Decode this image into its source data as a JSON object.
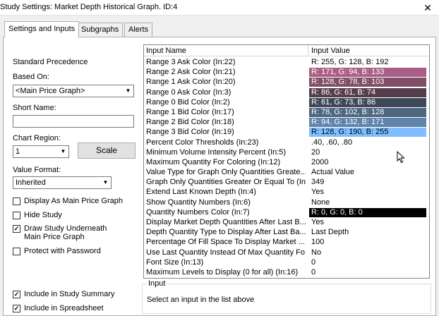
{
  "window": {
    "title": "Study Settings: Market Depth Historical Graph. ID:4",
    "close": "✕"
  },
  "tabs": [
    {
      "label": "Settings and Inputs"
    },
    {
      "label": "Subgraphs"
    },
    {
      "label": "Alerts"
    }
  ],
  "left": {
    "standard_precedence": "Standard Precedence",
    "based_on_label": "Based On:",
    "based_on_value": "<Main Price Graph>",
    "short_name_label": "Short Name:",
    "short_name_value": "",
    "chart_region_label": "Chart Region:",
    "chart_region_value": "1",
    "scale_button": "Scale",
    "value_format_label": "Value Format:",
    "value_format_value": "Inherited",
    "checkboxes": [
      {
        "label": "Display As Main Price Graph",
        "checked": false
      },
      {
        "label": "Hide Study",
        "checked": false
      },
      {
        "label": "Draw Study Underneath",
        "label2": "Main Price Graph",
        "checked": true
      },
      {
        "label": "Protect with Password",
        "checked": false
      },
      {
        "label": "Include in Study Summary",
        "checked": true
      },
      {
        "label": "Include in Spreadsheet",
        "checked": true
      }
    ]
  },
  "grid": {
    "col_name": "Input Name",
    "col_value": "Input Value",
    "rows": [
      {
        "name": "Range 3 Ask Color   (In:22)",
        "value": "R: 255, G: 128, B: 192",
        "bg": "#ffffff",
        "fg": "#000000"
      },
      {
        "name": "Range 2 Ask Color   (In:21)",
        "value": "R: 171, G: 94, B: 133",
        "bg": "#ab5e85",
        "fg": "#ffffff"
      },
      {
        "name": "Range 1 Ask Color   (In:20)",
        "value": "R: 128, G: 78, B: 103",
        "bg": "#804e67",
        "fg": "#ffffff"
      },
      {
        "name": "Range 0 Ask Color   (In:3)",
        "value": "R: 86, G: 61, B: 74",
        "bg": "#563d4a",
        "fg": "#ffffff"
      },
      {
        "name": "Range 0 Bid Color   (In:2)",
        "value": "R: 61, G: 73, B: 86",
        "bg": "#3d4956",
        "fg": "#ffffff"
      },
      {
        "name": "Range 1 Bid Color   (In:17)",
        "value": "R: 78, G: 102, B: 128",
        "bg": "#4e6680",
        "fg": "#ffffff"
      },
      {
        "name": "Range 2 Bid Color   (In:18)",
        "value": "R: 94, G: 132, B: 171",
        "bg": "#5e84ab",
        "fg": "#ffffff"
      },
      {
        "name": "Range 3 Bid Color   (In:19)",
        "value": "R: 128, G: 190, B: 255",
        "bg": "#80beff",
        "fg": "#000000"
      },
      {
        "name": "Percent Color Thresholds   (In:23)",
        "value": ".40, .60, .80",
        "bg": "#ffffff",
        "fg": "#000000"
      },
      {
        "name": "Minimum Volume Intensity Percent   (In:5)",
        "value": "20",
        "bg": "#ffffff",
        "fg": "#000000"
      },
      {
        "name": "Maximum Quantity For Coloring   (In:12)",
        "value": "2000",
        "bg": "#ffffff",
        "fg": "#000000"
      },
      {
        "name": "Value Type for Graph Only Quantities Greate...",
        "value": "Actual Value",
        "bg": "#ffffff",
        "fg": "#000000"
      },
      {
        "name": "Graph Only Quantities Greater Or Equal To   (In...",
        "value": "349",
        "bg": "#ffffff",
        "fg": "#000000"
      },
      {
        "name": "Extend Last Known Depth   (In:4)",
        "value": "Yes",
        "bg": "#ffffff",
        "fg": "#000000"
      },
      {
        "name": "Show Quantity Numbers   (In:6)",
        "value": "None",
        "bg": "#ffffff",
        "fg": "#000000"
      },
      {
        "name": "Quantity Numbers Color   (In:7)",
        "value": "R: 0, G: 0, B: 0",
        "bg": "#000000",
        "fg": "#ffffff"
      },
      {
        "name": "Display Market Depth Quantities After Last B...",
        "value": "Yes",
        "bg": "#ffffff",
        "fg": "#000000"
      },
      {
        "name": "Depth Quantity Type to Display After Last Ba...",
        "value": "Last Depth",
        "bg": "#ffffff",
        "fg": "#000000"
      },
      {
        "name": "Percentage Of Fill Space To Display Market ...",
        "value": "100",
        "bg": "#ffffff",
        "fg": "#000000"
      },
      {
        "name": "Use Last Quantity Instead Of Max Quantity Fo...",
        "value": "No",
        "bg": "#ffffff",
        "fg": "#000000"
      },
      {
        "name": "Font Size   (In:13)",
        "value": "0",
        "bg": "#ffffff",
        "fg": "#000000"
      },
      {
        "name": "Maximum Levels to Display (0 for all)   (In:16)",
        "value": "0",
        "bg": "#ffffff",
        "fg": "#000000"
      }
    ]
  },
  "input_group": {
    "title": "Input",
    "text": "Select an input in the list above"
  }
}
